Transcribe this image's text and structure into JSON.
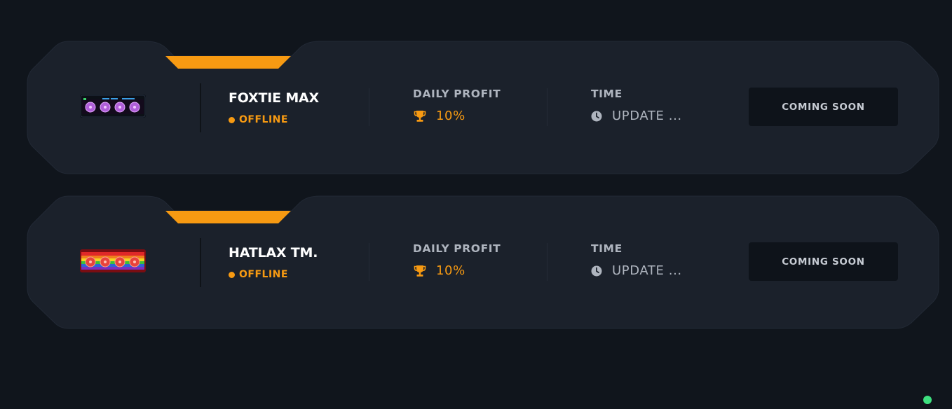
{
  "cards": [
    {
      "name": "FOXTIE MAX",
      "status": "OFFLINE",
      "profit_label": "DAILY PROFIT",
      "profit_value": "10%",
      "time_label": "TIME",
      "time_value": "UPDATE ...",
      "button_label": "COMING SOON",
      "thumbnail": "purple-fans-device"
    },
    {
      "name": "HATLAX TM.",
      "status": "OFFLINE",
      "profit_label": "DAILY PROFIT",
      "profit_value": "10%",
      "time_label": "TIME",
      "time_value": "UPDATE ...",
      "button_label": "COMING SOON",
      "thumbnail": "rainbow-fans-device"
    }
  ],
  "colors": {
    "background": "#10151c",
    "card": "#1b212b",
    "accent": "#f79a12",
    "button": "#0e131a",
    "online": "#3ee07f"
  },
  "icons": {
    "profit": "trophy-icon",
    "time": "clock-icon",
    "status": "status-dot"
  }
}
